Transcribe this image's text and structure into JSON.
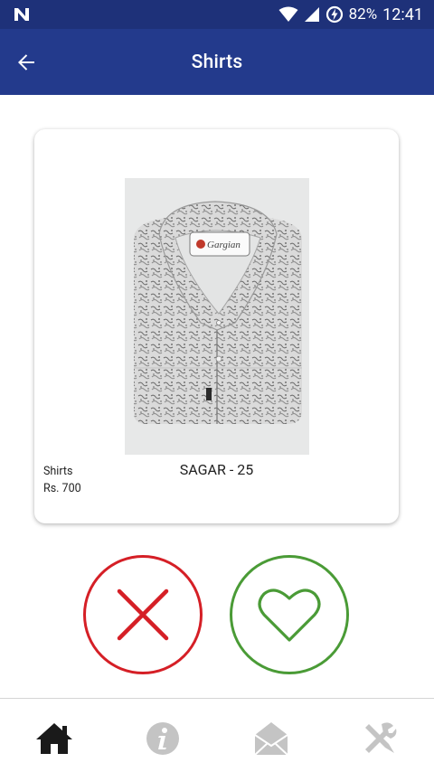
{
  "status_bar": {
    "notification_icon": "n-notification-icon",
    "battery_percent": "82%",
    "time": "12:41"
  },
  "app_bar": {
    "title": "Shirts",
    "back_icon": "arrow-left-icon",
    "background": "#233a8c"
  },
  "product": {
    "name": "SAGAR - 25",
    "category": "Shirts",
    "price": "Rs. 700",
    "image_label": "Gargian"
  },
  "actions": {
    "reject_icon": "close-icon",
    "reject_color": "#d51f26",
    "like_icon": "heart-icon",
    "like_color": "#4a9b36"
  },
  "bottom_nav": {
    "items": [
      {
        "icon": "home-icon",
        "active": true
      },
      {
        "icon": "info-icon",
        "active": false
      },
      {
        "icon": "mail-icon",
        "active": false
      },
      {
        "icon": "tools-icon",
        "active": false
      }
    ]
  }
}
